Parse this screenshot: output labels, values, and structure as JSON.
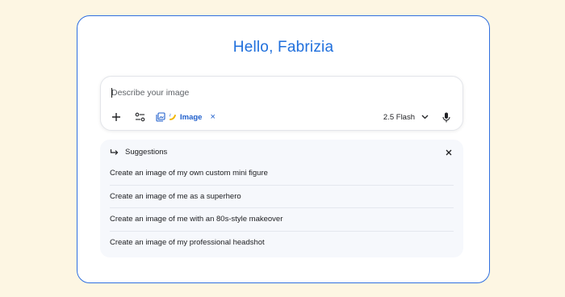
{
  "greeting": "Hello, Fabrizia",
  "prompt": {
    "placeholder": "Describe your image",
    "value": ""
  },
  "toolbar": {
    "plus_icon": "plus-icon",
    "tools_icon": "tune-icon",
    "image_chip_label": "Image",
    "image_chip_icon": "image-gallery-icon",
    "image_chip_close": "×",
    "model_label": "2.5 Flash",
    "model_icon": "chevron-down-icon",
    "mic_icon": "microphone-icon"
  },
  "suggestions": {
    "title": "Suggestions",
    "icon": "redirect-arrow-icon",
    "close_icon": "close-icon",
    "items": [
      "Create an image of my own custom mini figure",
      "Create an image of me as a superhero",
      "Create an image of me with an 80s-style makeover",
      "Create an image of my professional headshot"
    ]
  },
  "colors": {
    "background": "#fdf6e3",
    "accent": "#1f6fdc",
    "card_border": "#2f6fe0",
    "panel": "#f6f8fc"
  }
}
